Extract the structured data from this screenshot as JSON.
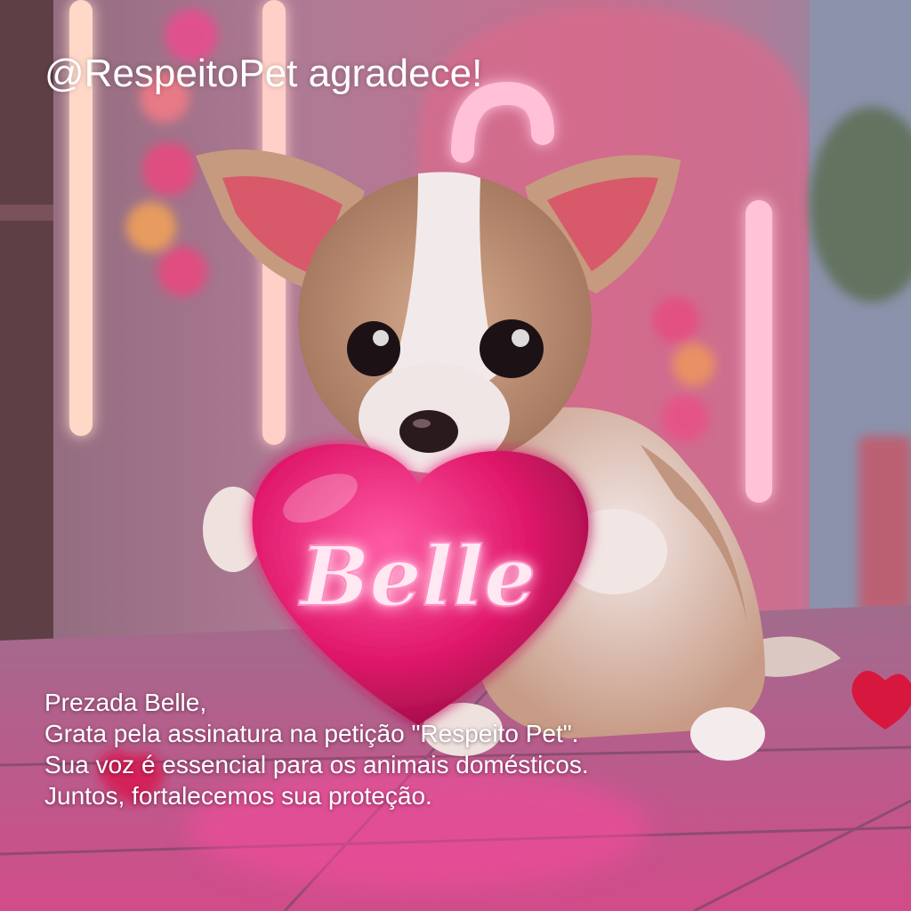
{
  "header": {
    "title": "@RespeitoPet agradece!"
  },
  "image": {
    "subject_icon": "puppy-with-heart-illustration",
    "heart_text": "Belle",
    "neon_color": "#ff3d8b",
    "heart_color": "#e0186a"
  },
  "message": {
    "greeting": "Prezada Belle,",
    "line1": "Grata pela assinatura na petição \"Respeito Pet\".",
    "line2": "Sua voz é essencial para os animais domésticos.",
    "line3": "Juntos, fortalecemos sua proteção."
  }
}
